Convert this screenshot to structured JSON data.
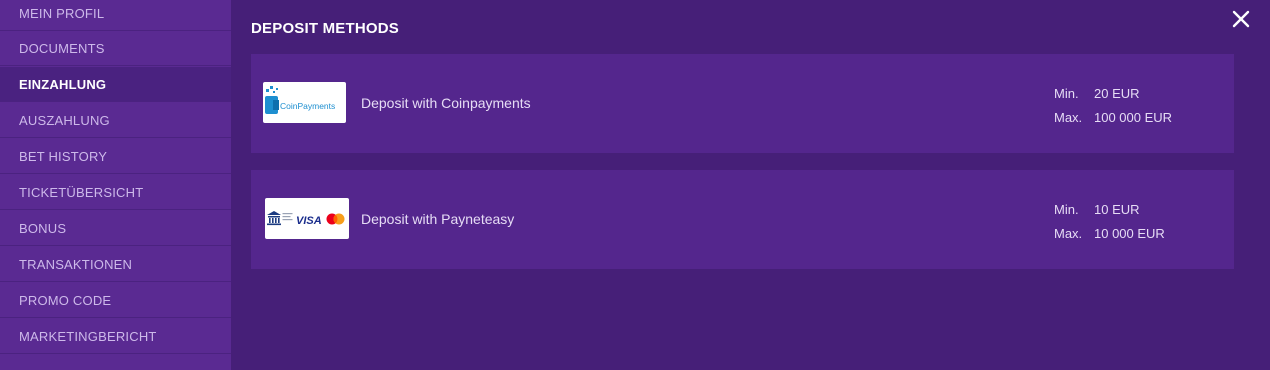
{
  "sidebar": {
    "items": [
      {
        "label": "MEIN PROFIL"
      },
      {
        "label": "DOCUMENTS"
      },
      {
        "label": "EINZAHLUNG"
      },
      {
        "label": "AUSZAHLUNG"
      },
      {
        "label": "BET HISTORY"
      },
      {
        "label": "TICKETÜBERSICHT"
      },
      {
        "label": "BONUS"
      },
      {
        "label": "TRANSAKTIONEN"
      },
      {
        "label": "PROMO CODE"
      },
      {
        "label": "MARKETINGBERICHT"
      }
    ],
    "active_item": "EINZAHLUNG"
  },
  "main": {
    "title": "DEPOSIT METHODS",
    "close_icon": "close-icon",
    "methods": [
      {
        "label": "Deposit with Coinpayments",
        "logo_text": "CoinPayments",
        "min_label": "Min.",
        "min_value": "20 EUR",
        "max_label": "Max.",
        "max_value": "100 000 EUR"
      },
      {
        "label": "Deposit with Payneteasy",
        "logo_text": "VISA",
        "min_label": "Min.",
        "min_value": "10 EUR",
        "max_label": "Max.",
        "max_value": "10 000 EUR"
      }
    ]
  },
  "colors": {
    "background": "#461f78",
    "sidebar": "#5a2a92",
    "card": "#54268d",
    "active_item": "#4a2280"
  }
}
